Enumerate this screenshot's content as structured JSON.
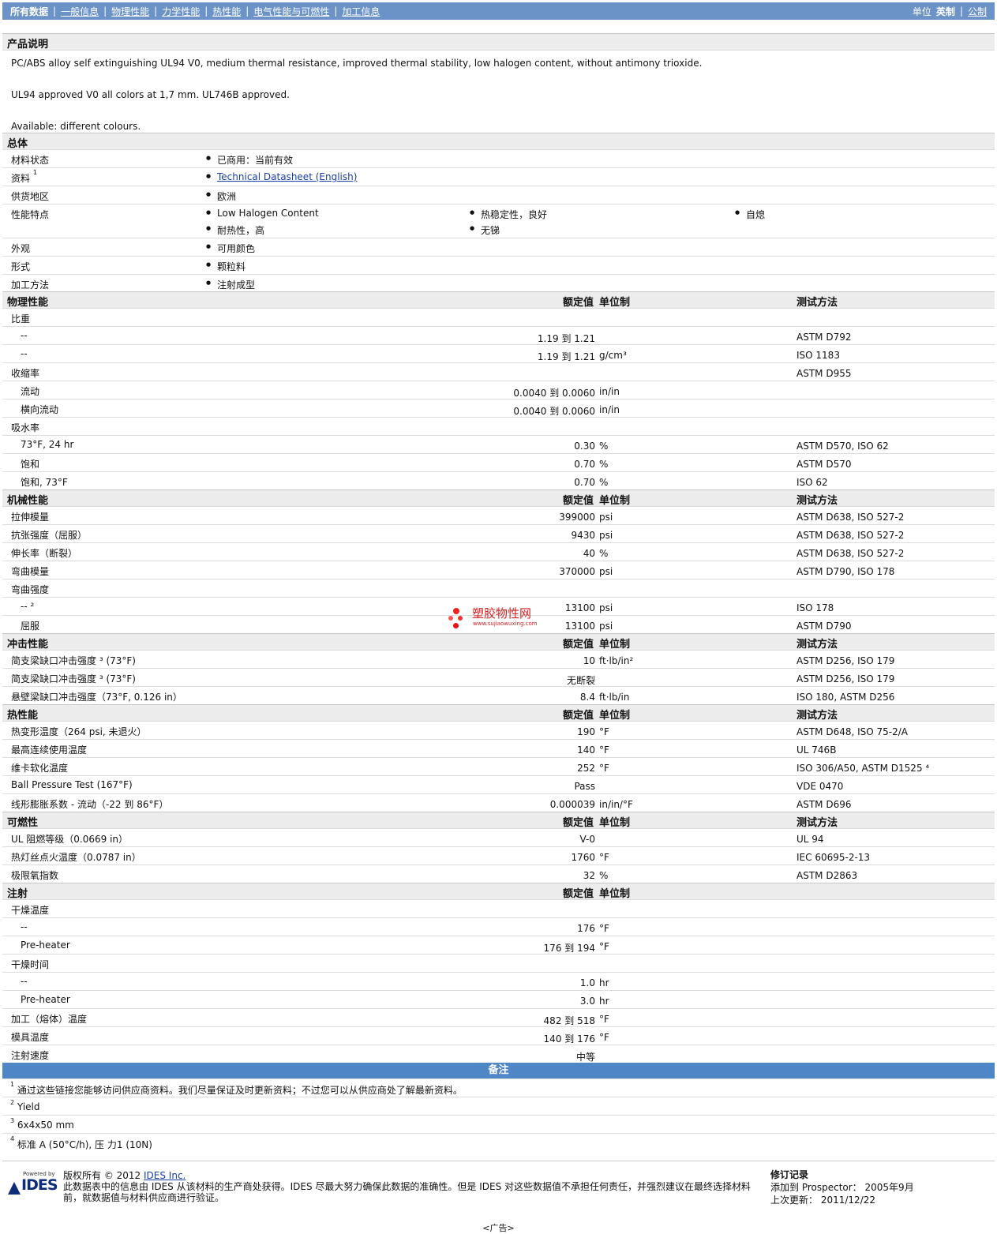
{
  "nav": {
    "tabs": [
      "所有数据",
      "一般信息",
      "物理性能",
      "力学性能",
      "热性能",
      "电气性能与可燃性",
      "加工信息"
    ],
    "units_label": "单位",
    "units_selected": "英制",
    "units_other": "公制"
  },
  "product": {
    "heading": "产品说明",
    "desc": [
      "PC/ABS alloy self extinguishing UL94 V0, medium thermal resistance, improved thermal stability, low halogen content, without antimony trioxide.",
      "UL94 approved V0 all colors at 1,7 mm. UL746B approved.",
      "Available: different colours."
    ]
  },
  "general": {
    "heading": "总体",
    "status_label": "材料状态",
    "status_value": "已商用：当前有效",
    "docs_label": "资料",
    "docs_sup": "1",
    "docs_link": "Technical Datasheet (English)",
    "region_label": "供货地区",
    "region_value": "欧洲",
    "features_label": "性能特点",
    "features": [
      "Low Halogen Content",
      "热稳定性，良好",
      "自熄",
      "耐热性，高",
      "无锑"
    ],
    "appearance_label": "外观",
    "appearance_value": "可用颜色",
    "form_label": "形式",
    "form_value": "颗粒料",
    "process_label": "加工方法",
    "process_value": "注射成型"
  },
  "headers": {
    "nominal": "额定值",
    "unit": "单位制",
    "method": "测试方法"
  },
  "physical": {
    "heading": "物理性能",
    "rows": [
      {
        "label": "比重",
        "sub": false,
        "value": "",
        "unit": "",
        "method": ""
      },
      {
        "label": "--",
        "sub": true,
        "value": "1.19 到  1.21",
        "unit": "",
        "method": "ASTM D792"
      },
      {
        "label": "--",
        "sub": true,
        "value": "1.19 到  1.21",
        "unit": "g/cm³",
        "method": "ISO 1183"
      },
      {
        "label": "收缩率",
        "sub": false,
        "value": "",
        "unit": "",
        "method": "ASTM D955"
      },
      {
        "label": "流动",
        "sub": true,
        "value": "0.0040 到  0.0060",
        "unit": "in/in",
        "method": ""
      },
      {
        "label": "横向流动",
        "sub": true,
        "value": "0.0040 到  0.0060",
        "unit": "in/in",
        "method": ""
      },
      {
        "label": "吸水率",
        "sub": false,
        "value": "",
        "unit": "",
        "method": ""
      },
      {
        "label": "73°F, 24 hr",
        "sub": true,
        "value": "0.30",
        "unit": "%",
        "method": "ASTM D570, ISO 62"
      },
      {
        "label": "饱和",
        "sub": true,
        "value": "0.70",
        "unit": "%",
        "method": "ASTM D570"
      },
      {
        "label": "饱和, 73°F",
        "sub": true,
        "value": "0.70",
        "unit": "%",
        "method": "ISO 62"
      }
    ]
  },
  "mechanical": {
    "heading": "机械性能",
    "rows": [
      {
        "label": "拉伸模量",
        "sub": false,
        "value": "399000",
        "unit": "psi",
        "method": "ASTM D638, ISO 527-2"
      },
      {
        "label": "抗张强度（屈服）",
        "sub": false,
        "value": "9430",
        "unit": "psi",
        "method": "ASTM D638, ISO 527-2"
      },
      {
        "label": "伸长率（断裂）",
        "sub": false,
        "value": "40",
        "unit": "%",
        "method": "ASTM D638, ISO 527-2"
      },
      {
        "label": "弯曲模量",
        "sub": false,
        "value": "370000",
        "unit": "psi",
        "method": "ASTM D790, ISO 178"
      },
      {
        "label": "弯曲强度",
        "sub": false,
        "value": "",
        "unit": "",
        "method": ""
      },
      {
        "label": "-- ²",
        "sub": true,
        "value": "13100",
        "unit": "psi",
        "method": "ISO 178"
      },
      {
        "label": "屈服",
        "sub": true,
        "value": "13100",
        "unit": "psi",
        "method": "ASTM D790"
      }
    ]
  },
  "impact": {
    "heading": "冲击性能",
    "rows": [
      {
        "label": "简支梁缺口冲击强度 ³ (73°F)",
        "sub": false,
        "value": "10",
        "unit": "ft·lb/in²",
        "method": "ASTM D256, ISO 179"
      },
      {
        "label": "简支梁缺口冲击强度 ³ (73°F)",
        "sub": false,
        "value": "无断裂",
        "unit": "",
        "method": "ASTM D256, ISO 179"
      },
      {
        "label": "悬壁梁缺口冲击强度（73°F, 0.126 in）",
        "sub": false,
        "value": "8.4",
        "unit": "ft·lb/in",
        "method": "ISO 180, ASTM D256"
      }
    ]
  },
  "thermal": {
    "heading": "热性能",
    "rows": [
      {
        "label": "热变形温度（264 psi, 未退火）",
        "sub": false,
        "value": "190",
        "unit": "°F",
        "method": "ASTM D648, ISO 75-2/A"
      },
      {
        "label": "最高连续使用温度",
        "sub": false,
        "value": "140",
        "unit": "°F",
        "method": "UL 746B"
      },
      {
        "label": "维卡软化温度",
        "sub": false,
        "value": "252",
        "unit": "°F",
        "method": "ISO 306/A50, ASTM D1525 ⁴"
      },
      {
        "label": "Ball Pressure Test (167°F)",
        "sub": false,
        "value": "Pass",
        "unit": "",
        "method": "VDE 0470"
      },
      {
        "label": "线形膨胀系数 - 流动（-22 到  86°F）",
        "sub": false,
        "value": "0.000039",
        "unit": "in/in/°F",
        "method": "ASTM D696"
      }
    ]
  },
  "flammability": {
    "heading": "可燃性",
    "rows": [
      {
        "label": "UL 阻燃等级（0.0669 in）",
        "sub": false,
        "value": "V-0",
        "unit": "",
        "method": "UL 94"
      },
      {
        "label": "热灯丝点火温度（0.0787 in）",
        "sub": false,
        "value": "1760",
        "unit": "°F",
        "method": "IEC 60695-2-13"
      },
      {
        "label": "极限氧指数",
        "sub": false,
        "value": "32",
        "unit": "%",
        "method": "ASTM D2863"
      }
    ]
  },
  "injection": {
    "heading": "注射",
    "rows": [
      {
        "label": "干燥温度",
        "sub": false,
        "value": "",
        "unit": "",
        "method": ""
      },
      {
        "label": "--",
        "sub": true,
        "value": "176",
        "unit": "°F",
        "method": ""
      },
      {
        "label": "Pre-heater",
        "sub": true,
        "value": "176 到  194",
        "unit": "°F",
        "method": ""
      },
      {
        "label": "干燥时间",
        "sub": false,
        "value": "",
        "unit": "",
        "method": ""
      },
      {
        "label": "--",
        "sub": true,
        "value": "1.0",
        "unit": "hr",
        "method": ""
      },
      {
        "label": "Pre-heater",
        "sub": true,
        "value": "3.0",
        "unit": "hr",
        "method": ""
      },
      {
        "label": "加工（熔体）温度",
        "sub": false,
        "value": "482 到  518",
        "unit": "°F",
        "method": ""
      },
      {
        "label": "模具温度",
        "sub": false,
        "value": "140 到  176",
        "unit": "°F",
        "method": ""
      },
      {
        "label": "注射速度",
        "sub": false,
        "value": "中等",
        "unit": "",
        "method": ""
      }
    ]
  },
  "notes": {
    "heading": "备注",
    "items": [
      {
        "num": "1",
        "text": "通过这些链接您能够访问供应商资料。我们尽量保证及时更新资料；不过您可以从供应商处了解最新资料。"
      },
      {
        "num": "2",
        "text": "Yield"
      },
      {
        "num": "3",
        "text": "6x4x50 mm"
      },
      {
        "num": "4",
        "text": "标准  A (50°C/h), 压  力1 (10N)"
      }
    ]
  },
  "footer": {
    "logo_powered": "Powered by",
    "logo_text": "IDES",
    "copyright_prefix": "版权所有  © 2012",
    "copyright_link": "IDES Inc.",
    "disclaimer": "此数据表中的信息由  IDES 从该材料的生产商处获得。IDES 尽最大努力确保此数据的准确性。但是  IDES 对这些数据值不承担任何责任，并强烈建议在最终选择材料前，就数据值与材料供应商进行验证。",
    "rev_heading": "修订记录",
    "added_label": "添加到  Prospector：",
    "added_value": "2005年9月",
    "updated_label": "上次更新：",
    "updated_value": "2011/12/22"
  },
  "watermark": {
    "cn": "塑胶物性网",
    "url": "www.sujiaowuxing.com"
  },
  "ad": "<广告>"
}
